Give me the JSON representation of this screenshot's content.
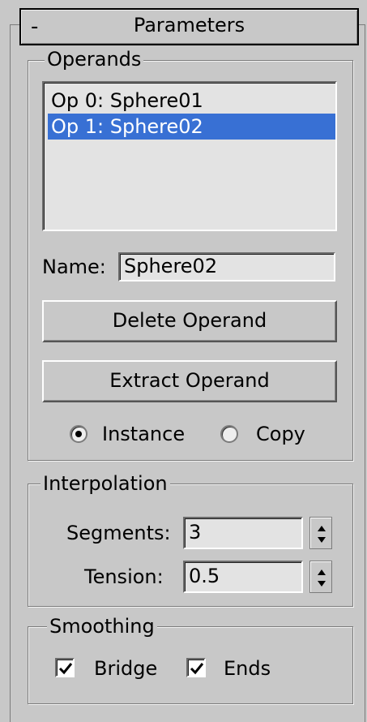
{
  "rollout": {
    "collapse_symbol": "-",
    "title": "Parameters"
  },
  "operands": {
    "legend": "Operands",
    "items": [
      {
        "label": "Op 0: Sphere01",
        "selected": false
      },
      {
        "label": "Op 1: Sphere02",
        "selected": true
      }
    ],
    "name_label": "Name:",
    "name_value": "Sphere02",
    "delete_button": "Delete Operand",
    "extract_button": "Extract Operand",
    "mode": {
      "instance_label": "Instance",
      "copy_label": "Copy",
      "selected": "Instance"
    }
  },
  "interpolation": {
    "legend": "Interpolation",
    "segments_label": "Segments:",
    "segments_value": "3",
    "tension_label": "Tension:",
    "tension_value": "0.5"
  },
  "smoothing": {
    "legend": "Smoothing",
    "bridge_label": "Bridge",
    "bridge_checked": true,
    "ends_label": "Ends",
    "ends_checked": true
  },
  "colors": {
    "panel_bg": "#c8c8c8",
    "selection_bg": "#3870d4",
    "field_bg": "#e3e3e3"
  }
}
